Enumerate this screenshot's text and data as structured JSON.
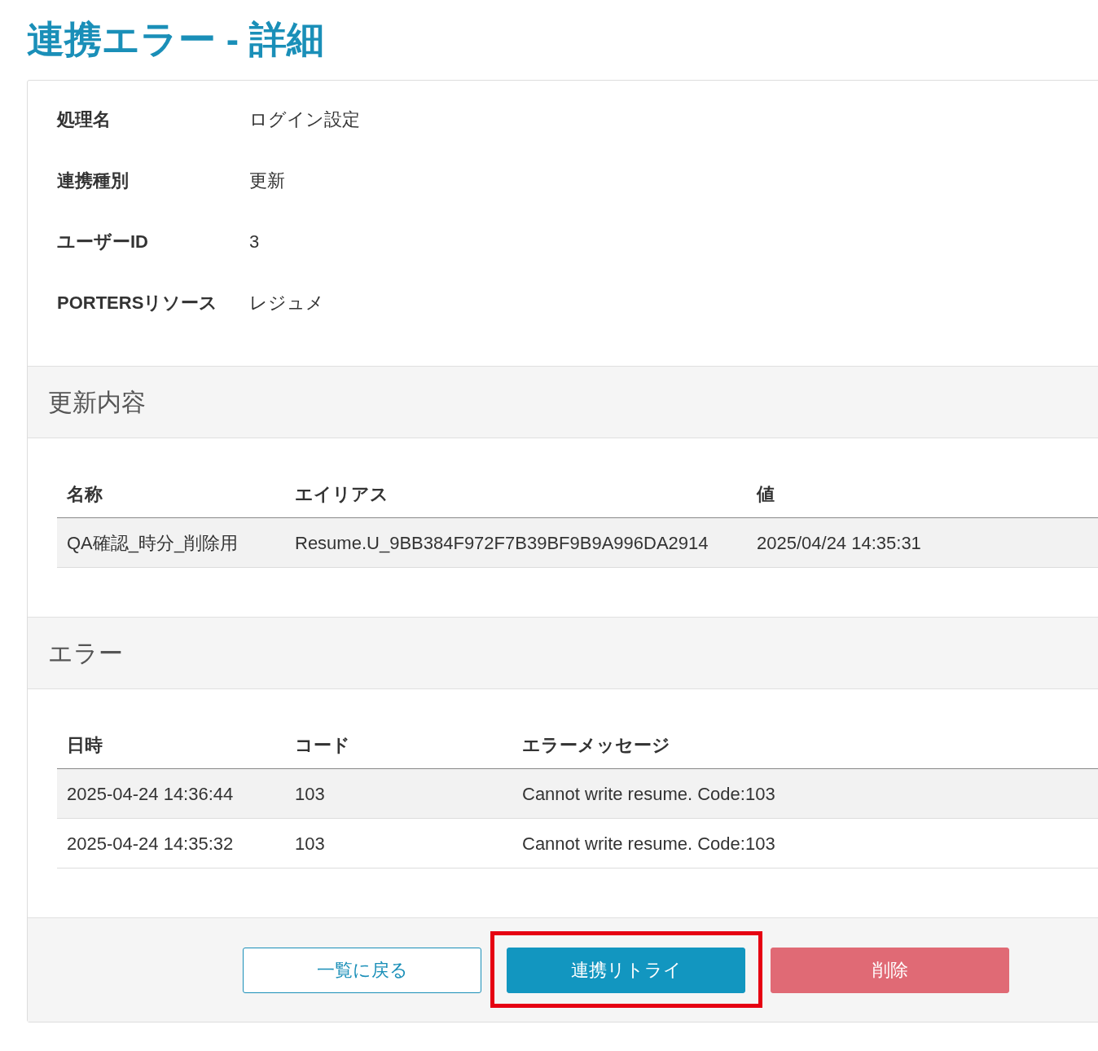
{
  "title": "連携エラー - 詳細",
  "details": [
    {
      "label": "処理名",
      "value": "ログイン設定"
    },
    {
      "label": "連携種別",
      "value": "更新"
    },
    {
      "label": "ユーザーID",
      "value": "3"
    },
    {
      "label": "PORTERSリソース",
      "value": "レジュメ"
    }
  ],
  "update_section": {
    "heading": "更新内容",
    "columns": [
      "名称",
      "エイリアス",
      "値"
    ],
    "rows": [
      [
        "QA確認_時分_削除用",
        "Resume.U_9BB384F972F7B39BF9B9A996DA2914",
        "2025/04/24 14:35:31"
      ]
    ]
  },
  "error_section": {
    "heading": "エラー",
    "columns": [
      "日時",
      "コード",
      "エラーメッセージ"
    ],
    "rows": [
      [
        "2025-04-24 14:36:44",
        "103",
        "Cannot write resume. Code:103"
      ],
      [
        "2025-04-24 14:35:32",
        "103",
        "Cannot write resume. Code:103"
      ]
    ]
  },
  "buttons": [
    {
      "label": "一覧に戻る",
      "kind": "outline",
      "highlighted": false
    },
    {
      "label": "連携リトライ",
      "kind": "primary",
      "highlighted": true
    },
    {
      "label": "削除",
      "kind": "danger",
      "highlighted": false
    }
  ]
}
